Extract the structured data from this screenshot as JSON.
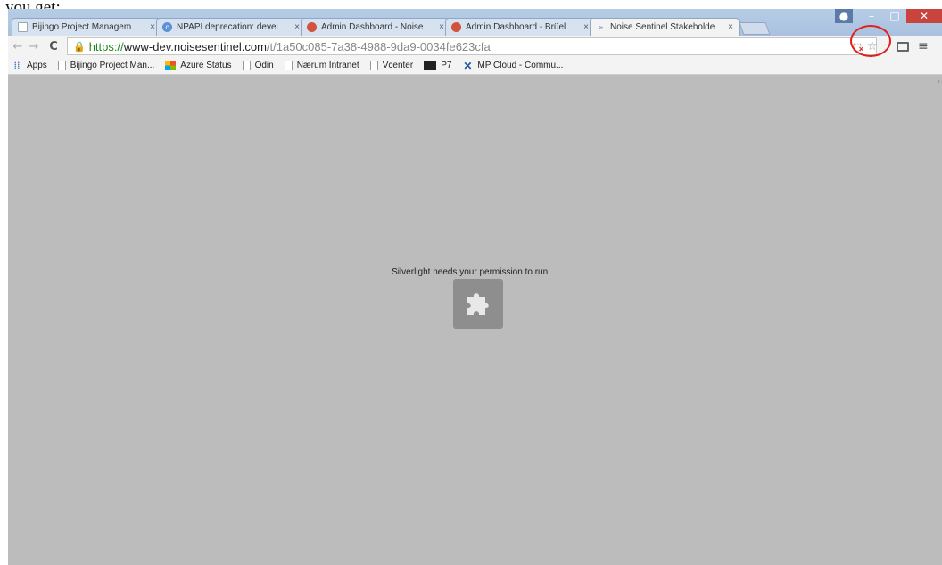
{
  "caption": "you get:",
  "tabs": [
    {
      "title": "Bijingo Project Managem",
      "icon": "document-icon",
      "active": false
    },
    {
      "title": "NPAPI deprecation: devel",
      "icon": "chrome-icon",
      "active": false
    },
    {
      "title": "Admin Dashboard - Noise",
      "icon": "admin-icon",
      "active": false
    },
    {
      "title": "Admin Dashboard - Brüel",
      "icon": "admin-icon",
      "active": false
    },
    {
      "title": "Noise Sentinel Stakeholde",
      "icon": "waves-icon",
      "active": true
    }
  ],
  "tab_close_glyph": "×",
  "address_bar": {
    "scheme": "https://",
    "host": "www-dev.noisesentinel.com",
    "path": "/t/1a50c085-7a38-4988-9da9-0034fe623cfa"
  },
  "bookmarks": [
    {
      "label": "Apps",
      "icon": "apps-grid-icon"
    },
    {
      "label": "Bijingo Project Man...",
      "icon": "document-icon"
    },
    {
      "label": "Azure Status",
      "icon": "windows-logo-icon"
    },
    {
      "label": "Odin",
      "icon": "document-icon"
    },
    {
      "label": "Nærum Intranet",
      "icon": "document-icon"
    },
    {
      "label": "Vcenter",
      "icon": "document-icon"
    },
    {
      "label": "P7",
      "icon": "p7-icon"
    },
    {
      "label": "MP Cloud - Commu...",
      "icon": "mp-cloud-icon"
    }
  ],
  "plugin": {
    "message": "Silverlight needs your permission to run.",
    "icon": "puzzle-piece-icon"
  },
  "colors": {
    "annotation_circle": "#e0201a",
    "content_background": "#bcbcbc",
    "plugin_tile": "#8e8e8e"
  }
}
